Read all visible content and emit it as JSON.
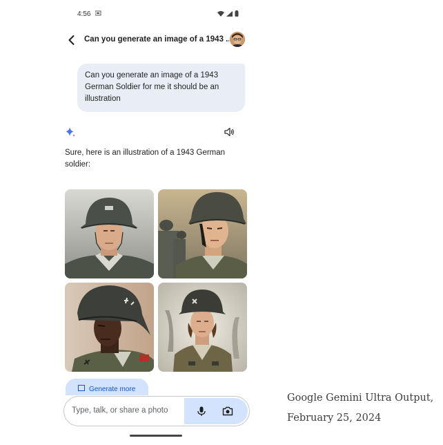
{
  "status_bar": {
    "time": "4:56"
  },
  "header": {
    "title": "Can you generate an image of a 1943 ..."
  },
  "user_message": {
    "text": "Can you generate an image of a 1943 German Soldier for me it should be an illustration"
  },
  "response": {
    "text": "Sure, here is an illustration of a 1943 German soldier:"
  },
  "images": [
    {
      "subject": "soldier-portrait-1"
    },
    {
      "subject": "soldier-portrait-2"
    },
    {
      "subject": "soldier-portrait-3"
    },
    {
      "subject": "soldier-portrait-4"
    }
  ],
  "generate_more": {
    "label": "Generate more"
  },
  "input": {
    "placeholder": "Type, talk, or share a photo"
  },
  "caption": {
    "line1": "Google Gemini Ultra Output,",
    "line2": "February 25, 2024"
  },
  "colors": {
    "user_bubble": "#e9eef6",
    "accent_blue": "#d3e3fd",
    "sparkle": "#4a78e0"
  },
  "icons": [
    "back-arrow-icon",
    "sparkle-icon",
    "speaker-icon",
    "mic-icon",
    "camera-icon",
    "wifi-icon",
    "signal-icon",
    "battery-icon"
  ]
}
